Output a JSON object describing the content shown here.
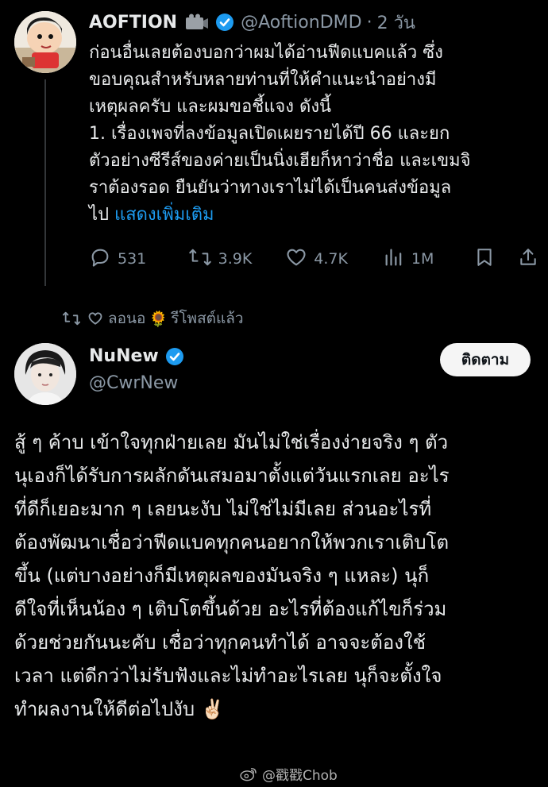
{
  "tweet1": {
    "author_name": "AOFTION",
    "handle": "@AoftionDMD",
    "separator": "·",
    "time": "2 วัน",
    "body": "ก่อนอื่นเลยต้องบอกว่าผมได้อ่านฟีดแบคแล้ว ซึ่ง\nขอบคุณสำหรับหลายท่านที่ให้คำแนะนำอย่างมี\nเหตุผลครับ และผมขอชี้แจง ดังนี้\n1. เรื่องเพจที่ลงข้อมูลเปิดเผยรายได้ปี 66 และยก\nตัวอย่างซีรีส์ของค่ายเป็นนิ่งเฮียก็หาว่าชื่อ และเขมจิ\nราต้องรอด ยืนยันว่าทางเราไม่ได้เป็นคนส่งข้อมูล\nไป ",
    "show_more": "แสดงเพิ่มเติม",
    "stats": {
      "replies": "531",
      "reposts": "3.9K",
      "likes": "4.7K",
      "views": "1M"
    }
  },
  "repost_banner": {
    "text": "ลอนอ",
    "emoji": "🌻",
    "suffix": "รีโพสต์แล้ว"
  },
  "tweet2": {
    "author_name": "NuNew",
    "handle": "@CwrNew",
    "follow_label": "ติดตาม",
    "body": "สู้ ๆ ค้าบ เข้าใจทุกฝ่ายเลย มันไม่ใช่เรื่องง่ายจริง ๆ ตัว\nนุเองก็ได้รับการผลักดันเสมอมาตั้งแต่วันแรกเลย อะไร\nที่ดีก็เยอะมาก ๆ เลยนะงับ ไม่ใช่ไม่มีเลย ส่วนอะไรที่\nต้องพัฒนาเชื่อว่าฟีดแบคทุกคนอยากให้พวกเราเติบโต\nขึ้น (แต่บางอย่างก็มีเหตุผลของมันจริง ๆ แหละ) นุก็\nดีใจที่เห็นน้อง ๆ เติบโตขึ้นด้วย อะไรที่ต้องแก้ไขก็ร่วม\nด้วยช่วยกันนะคับ เชื่อว่าทุกคนทำได้ อาจจะต้องใช้\nเวลา แต่ดีกว่าไม่รับฟังและไม่ทำอะไรเลย นุก็จะตั้งใจ\nทำผลงานให้ดีต่อไปงับ ",
    "emoji": "✌🏻"
  },
  "watermark": {
    "text": "@戳戳Chob"
  },
  "colors": {
    "background": "#000000",
    "text": "#e7e9ea",
    "muted": "#8b98a5",
    "link": "#1d9bf0",
    "verified": "#1d9bf0"
  },
  "icons": [
    "reply-icon",
    "repost-icon",
    "like-icon",
    "views-icon",
    "bookmark-icon",
    "share-icon",
    "verified-icon",
    "camera-icon",
    "weibo-icon"
  ]
}
